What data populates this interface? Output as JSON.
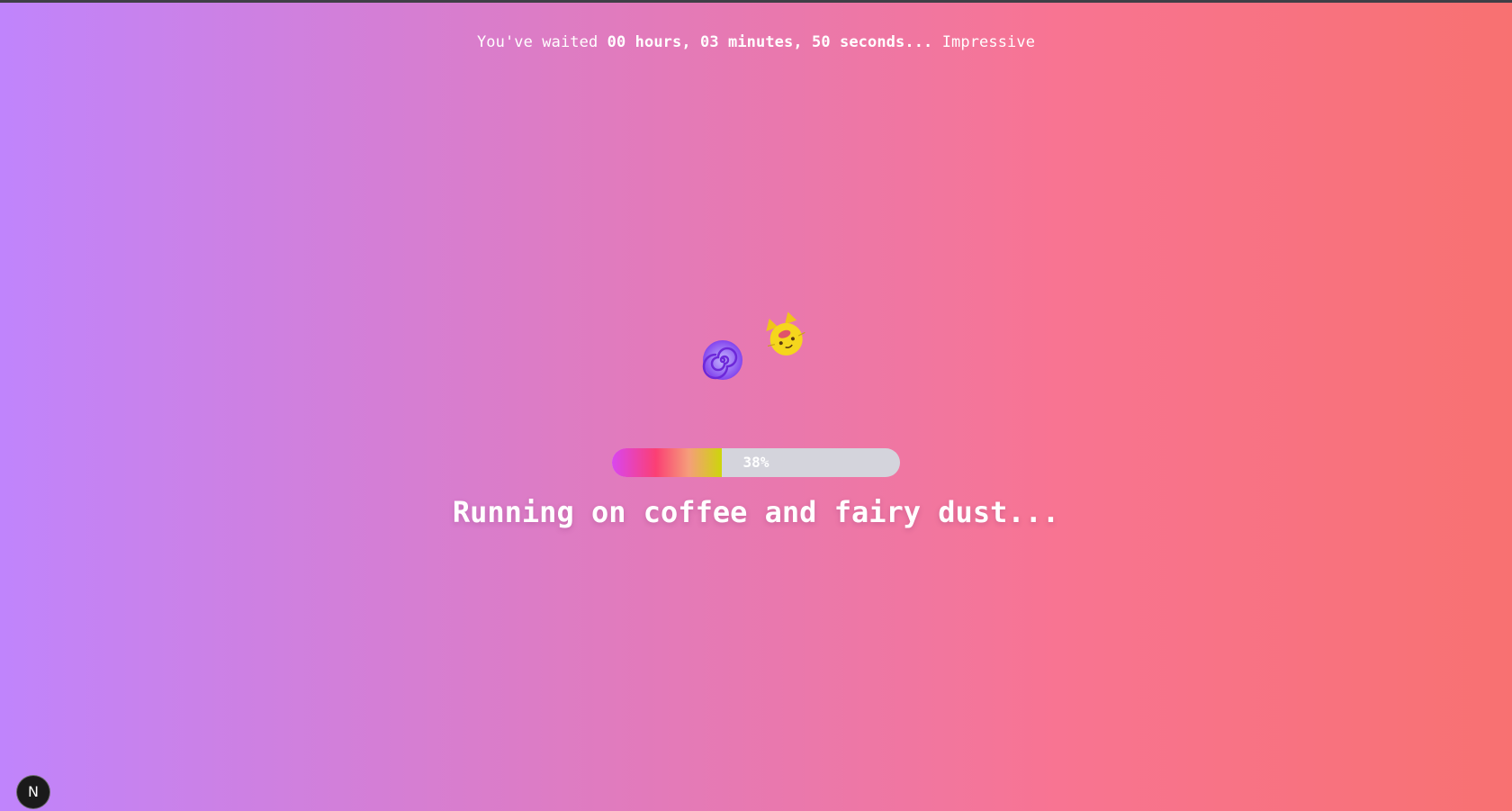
{
  "wait": {
    "prefix": "You've waited ",
    "elapsed": "00 hours, 03 minutes, 50 seconds...",
    "suffix": " Impressive"
  },
  "emojis": {
    "spiral": "spiral-icon",
    "cat": "cat-icon"
  },
  "progress": {
    "percent": 38,
    "label": "38%"
  },
  "message": "Running on coffee and fairy dust...",
  "badge": {
    "letter": "N",
    "icon": "nextjs-icon"
  }
}
